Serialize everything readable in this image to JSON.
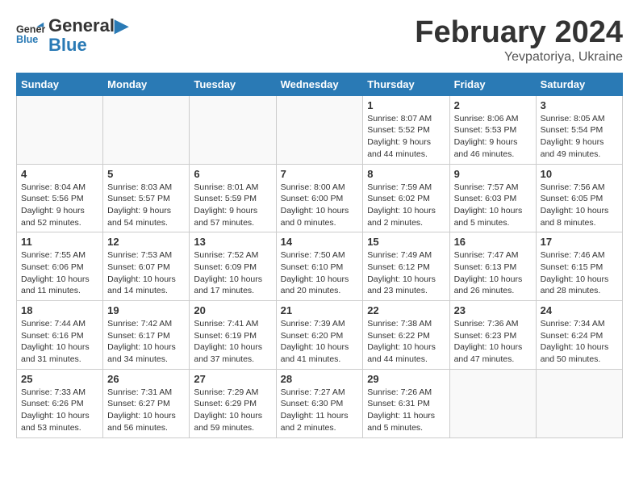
{
  "header": {
    "logo_line1": "General",
    "logo_line2": "Blue",
    "month": "February 2024",
    "location": "Yevpatoriya, Ukraine"
  },
  "weekdays": [
    "Sunday",
    "Monday",
    "Tuesday",
    "Wednesday",
    "Thursday",
    "Friday",
    "Saturday"
  ],
  "weeks": [
    [
      {
        "day": "",
        "info": ""
      },
      {
        "day": "",
        "info": ""
      },
      {
        "day": "",
        "info": ""
      },
      {
        "day": "",
        "info": ""
      },
      {
        "day": "1",
        "info": "Sunrise: 8:07 AM\nSunset: 5:52 PM\nDaylight: 9 hours\nand 44 minutes."
      },
      {
        "day": "2",
        "info": "Sunrise: 8:06 AM\nSunset: 5:53 PM\nDaylight: 9 hours\nand 46 minutes."
      },
      {
        "day": "3",
        "info": "Sunrise: 8:05 AM\nSunset: 5:54 PM\nDaylight: 9 hours\nand 49 minutes."
      }
    ],
    [
      {
        "day": "4",
        "info": "Sunrise: 8:04 AM\nSunset: 5:56 PM\nDaylight: 9 hours\nand 52 minutes."
      },
      {
        "day": "5",
        "info": "Sunrise: 8:03 AM\nSunset: 5:57 PM\nDaylight: 9 hours\nand 54 minutes."
      },
      {
        "day": "6",
        "info": "Sunrise: 8:01 AM\nSunset: 5:59 PM\nDaylight: 9 hours\nand 57 minutes."
      },
      {
        "day": "7",
        "info": "Sunrise: 8:00 AM\nSunset: 6:00 PM\nDaylight: 10 hours\nand 0 minutes."
      },
      {
        "day": "8",
        "info": "Sunrise: 7:59 AM\nSunset: 6:02 PM\nDaylight: 10 hours\nand 2 minutes."
      },
      {
        "day": "9",
        "info": "Sunrise: 7:57 AM\nSunset: 6:03 PM\nDaylight: 10 hours\nand 5 minutes."
      },
      {
        "day": "10",
        "info": "Sunrise: 7:56 AM\nSunset: 6:05 PM\nDaylight: 10 hours\nand 8 minutes."
      }
    ],
    [
      {
        "day": "11",
        "info": "Sunrise: 7:55 AM\nSunset: 6:06 PM\nDaylight: 10 hours\nand 11 minutes."
      },
      {
        "day": "12",
        "info": "Sunrise: 7:53 AM\nSunset: 6:07 PM\nDaylight: 10 hours\nand 14 minutes."
      },
      {
        "day": "13",
        "info": "Sunrise: 7:52 AM\nSunset: 6:09 PM\nDaylight: 10 hours\nand 17 minutes."
      },
      {
        "day": "14",
        "info": "Sunrise: 7:50 AM\nSunset: 6:10 PM\nDaylight: 10 hours\nand 20 minutes."
      },
      {
        "day": "15",
        "info": "Sunrise: 7:49 AM\nSunset: 6:12 PM\nDaylight: 10 hours\nand 23 minutes."
      },
      {
        "day": "16",
        "info": "Sunrise: 7:47 AM\nSunset: 6:13 PM\nDaylight: 10 hours\nand 26 minutes."
      },
      {
        "day": "17",
        "info": "Sunrise: 7:46 AM\nSunset: 6:15 PM\nDaylight: 10 hours\nand 28 minutes."
      }
    ],
    [
      {
        "day": "18",
        "info": "Sunrise: 7:44 AM\nSunset: 6:16 PM\nDaylight: 10 hours\nand 31 minutes."
      },
      {
        "day": "19",
        "info": "Sunrise: 7:42 AM\nSunset: 6:17 PM\nDaylight: 10 hours\nand 34 minutes."
      },
      {
        "day": "20",
        "info": "Sunrise: 7:41 AM\nSunset: 6:19 PM\nDaylight: 10 hours\nand 37 minutes."
      },
      {
        "day": "21",
        "info": "Sunrise: 7:39 AM\nSunset: 6:20 PM\nDaylight: 10 hours\nand 41 minutes."
      },
      {
        "day": "22",
        "info": "Sunrise: 7:38 AM\nSunset: 6:22 PM\nDaylight: 10 hours\nand 44 minutes."
      },
      {
        "day": "23",
        "info": "Sunrise: 7:36 AM\nSunset: 6:23 PM\nDaylight: 10 hours\nand 47 minutes."
      },
      {
        "day": "24",
        "info": "Sunrise: 7:34 AM\nSunset: 6:24 PM\nDaylight: 10 hours\nand 50 minutes."
      }
    ],
    [
      {
        "day": "25",
        "info": "Sunrise: 7:33 AM\nSunset: 6:26 PM\nDaylight: 10 hours\nand 53 minutes."
      },
      {
        "day": "26",
        "info": "Sunrise: 7:31 AM\nSunset: 6:27 PM\nDaylight: 10 hours\nand 56 minutes."
      },
      {
        "day": "27",
        "info": "Sunrise: 7:29 AM\nSunset: 6:29 PM\nDaylight: 10 hours\nand 59 minutes."
      },
      {
        "day": "28",
        "info": "Sunrise: 7:27 AM\nSunset: 6:30 PM\nDaylight: 11 hours\nand 2 minutes."
      },
      {
        "day": "29",
        "info": "Sunrise: 7:26 AM\nSunset: 6:31 PM\nDaylight: 11 hours\nand 5 minutes."
      },
      {
        "day": "",
        "info": ""
      },
      {
        "day": "",
        "info": ""
      }
    ]
  ]
}
